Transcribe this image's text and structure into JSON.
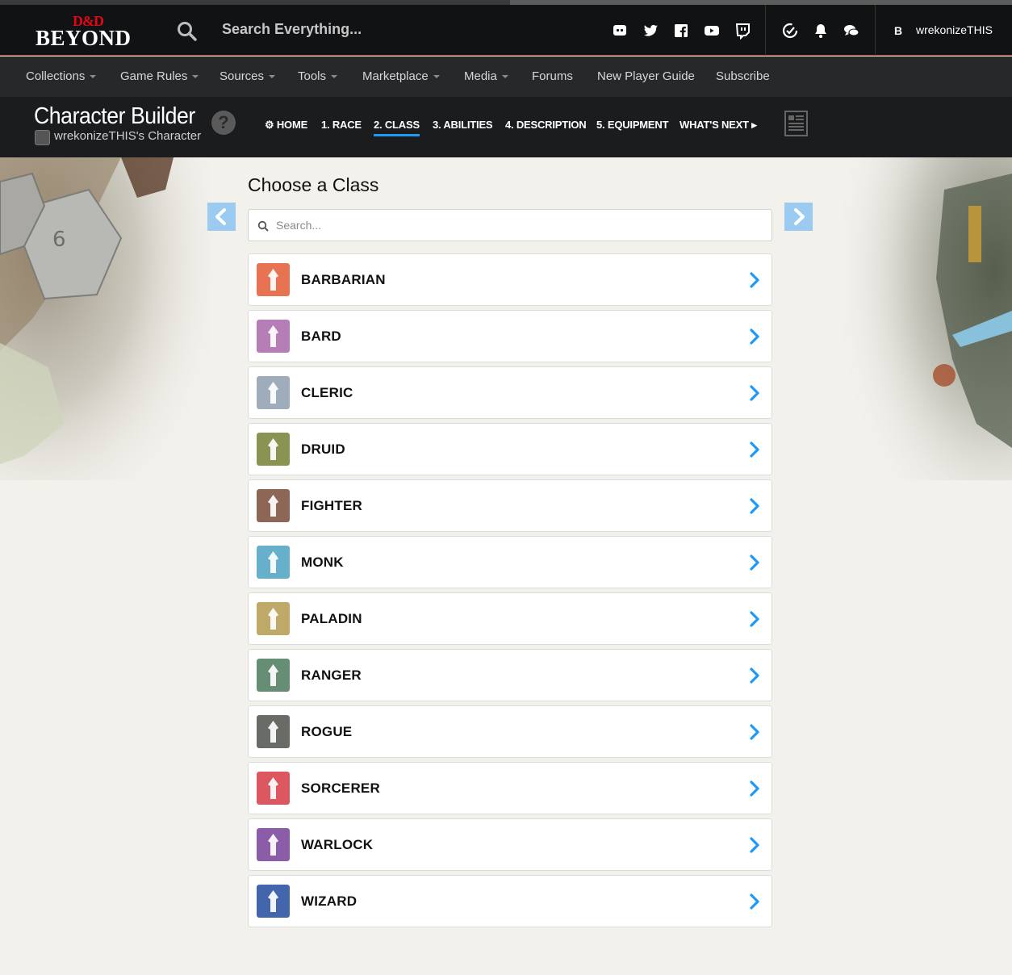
{
  "header": {
    "logo_top": "D&D",
    "logo_bottom": "BEYOND",
    "search_text": "Search Everything...",
    "user_badge": "B",
    "user_name": "wrekonizeTHIS",
    "social_icons": [
      "discord-icon",
      "twitter-icon",
      "facebook-icon",
      "youtube-icon",
      "twitch-icon"
    ],
    "action_icons": [
      "ddb-sync-icon",
      "bell-icon",
      "chat-icon"
    ]
  },
  "nav": {
    "items": [
      {
        "label": "Collections",
        "dropdown": true
      },
      {
        "label": "Game Rules",
        "dropdown": true
      },
      {
        "label": "Sources",
        "dropdown": true
      },
      {
        "label": "Tools",
        "dropdown": true
      },
      {
        "label": "Marketplace",
        "dropdown": true
      },
      {
        "label": "Media",
        "dropdown": true
      },
      {
        "label": "Forums",
        "dropdown": false
      },
      {
        "label": "New Player Guide",
        "dropdown": false
      },
      {
        "label": "Subscribe",
        "dropdown": false
      }
    ]
  },
  "builder": {
    "title": "Character Builder",
    "subtitle": "wrekonizeTHIS's Character",
    "help": "?",
    "steps": [
      {
        "label": "⚙ HOME",
        "active": false
      },
      {
        "label": "1. RACE",
        "active": false
      },
      {
        "label": "2. CLASS",
        "active": true
      },
      {
        "label": "3. ABILITIES",
        "active": false
      },
      {
        "label": "4. DESCRIPTION",
        "active": false
      },
      {
        "label": "5. EQUIPMENT",
        "active": false
      },
      {
        "label": "WHAT'S NEXT ▸",
        "active": false
      }
    ]
  },
  "main": {
    "title": "Choose a Class",
    "search_placeholder": "Search...",
    "classes": [
      {
        "name": "BARBARIAN",
        "color": "#e5603c"
      },
      {
        "name": "BARD",
        "color": "#ab6dac"
      },
      {
        "name": "CLERIC",
        "color": "#91a1b2"
      },
      {
        "name": "DRUID",
        "color": "#7a853b"
      },
      {
        "name": "FIGHTER",
        "color": "#7f513e"
      },
      {
        "name": "MONK",
        "color": "#51a5c5"
      },
      {
        "name": "PALADIN",
        "color": "#b59e54"
      },
      {
        "name": "RANGER",
        "color": "#507f62"
      },
      {
        "name": "ROGUE",
        "color": "#555752"
      },
      {
        "name": "SORCERER",
        "color": "#d9404c"
      },
      {
        "name": "WARLOCK",
        "color": "#7b469b"
      },
      {
        "name": "WIZARD",
        "color": "#2a50a1"
      }
    ]
  },
  "colors": {
    "accent": "#1c9af6",
    "chevron": "#1c9af6",
    "header_bg": "#111214",
    "nav_bg": "#26282a"
  }
}
